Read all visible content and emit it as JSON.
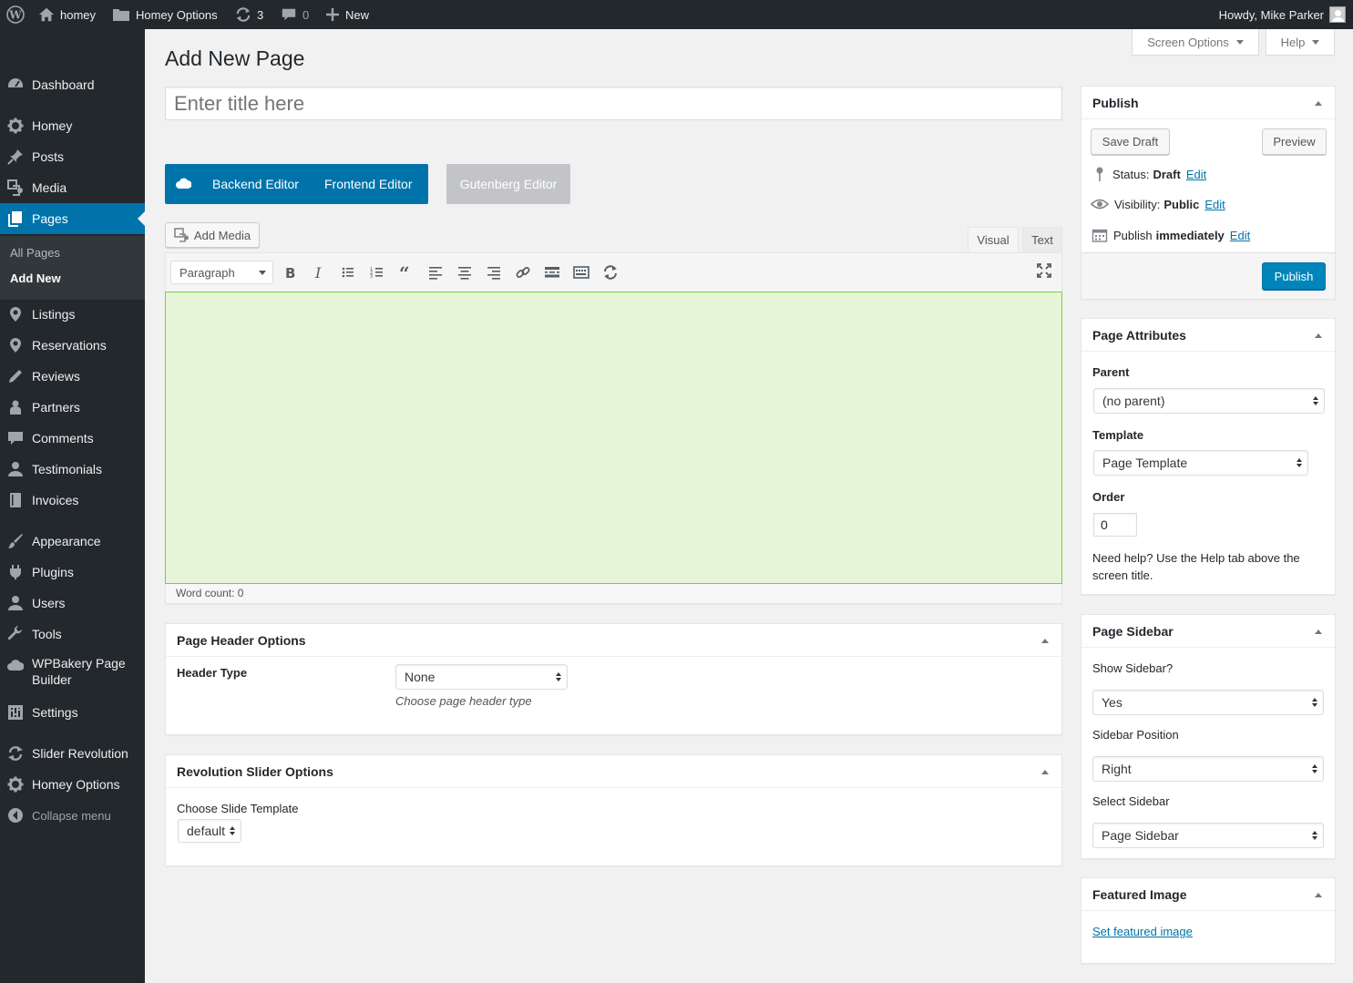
{
  "admin_bar": {
    "site_name": "homey",
    "options_label": "Homey Options",
    "updates_count": "3",
    "comments_count": "0",
    "new_label": "New",
    "greeting": "Howdy, Mike Parker"
  },
  "sidebar": {
    "items": [
      {
        "label": "Dashboard",
        "icon": "dashboard-icon"
      },
      {
        "label": "Homey",
        "icon": "gear-icon"
      },
      {
        "label": "Posts",
        "icon": "pin-icon"
      },
      {
        "label": "Media",
        "icon": "media-icon"
      },
      {
        "label": "Pages",
        "icon": "pages-icon"
      },
      {
        "label": "Listings",
        "icon": "location-icon"
      },
      {
        "label": "Reservations",
        "icon": "location-icon"
      },
      {
        "label": "Reviews",
        "icon": "pencil-icon"
      },
      {
        "label": "Partners",
        "icon": "partners-icon"
      },
      {
        "label": "Comments",
        "icon": "comment-icon"
      },
      {
        "label": "Testimonials",
        "icon": "user-icon"
      },
      {
        "label": "Invoices",
        "icon": "book-icon"
      },
      {
        "label": "Appearance",
        "icon": "brush-icon"
      },
      {
        "label": "Plugins",
        "icon": "plug-icon"
      },
      {
        "label": "Users",
        "icon": "user-icon"
      },
      {
        "label": "Tools",
        "icon": "wrench-icon"
      },
      {
        "label": "WPBakery Page Builder",
        "icon": "cloud-icon"
      },
      {
        "label": "Settings",
        "icon": "settings-icon"
      },
      {
        "label": "Slider Revolution",
        "icon": "refresh-icon"
      },
      {
        "label": "Homey Options",
        "icon": "gear-icon"
      },
      {
        "label": "Collapse menu",
        "icon": "collapse-icon"
      }
    ],
    "submenu": [
      "All Pages",
      "Add New"
    ]
  },
  "header": {
    "screen_options": "Screen Options",
    "help": "Help",
    "page_title": "Add New Page",
    "title_placeholder": "Enter title here"
  },
  "editor_switch": {
    "backend": "Backend Editor",
    "frontend": "Frontend Editor",
    "gutenberg": "Gutenberg Editor"
  },
  "editor": {
    "add_media": "Add Media",
    "tab_visual": "Visual",
    "tab_text": "Text",
    "format_select": "Paragraph",
    "word_count": "Word count: 0",
    "area_color": "#e6f5d7"
  },
  "page_header_options": {
    "title": "Page Header Options",
    "field_label": "Header Type",
    "value": "None",
    "hint": "Choose page header type"
  },
  "revolution_slider": {
    "title": "Revolution Slider Options",
    "field_label": "Choose Slide Template",
    "value": "default"
  },
  "publish": {
    "title": "Publish",
    "save_draft": "Save Draft",
    "preview": "Preview",
    "status_label": "Status:",
    "status_value": "Draft",
    "visibility_label": "Visibility:",
    "visibility_value": "Public",
    "publish_label": "Publish",
    "publish_value": "immediately",
    "edit": "Edit",
    "publish_button": "Publish"
  },
  "page_attributes": {
    "title": "Page Attributes",
    "parent_label": "Parent",
    "parent_value": "(no parent)",
    "template_label": "Template",
    "template_value": "Page Template",
    "order_label": "Order",
    "order_value": "0",
    "help_text": "Need help? Use the Help tab above the screen title."
  },
  "page_sidebar": {
    "title": "Page Sidebar",
    "show_label": "Show Sidebar?",
    "show_value": "Yes",
    "position_label": "Sidebar Position",
    "position_value": "Right",
    "select_label": "Select Sidebar",
    "select_value": "Page Sidebar"
  },
  "featured_image": {
    "title": "Featured Image",
    "link": "Set featured image"
  },
  "colors": {
    "accent": "#0073aa",
    "admin_bg": "#23282d"
  }
}
